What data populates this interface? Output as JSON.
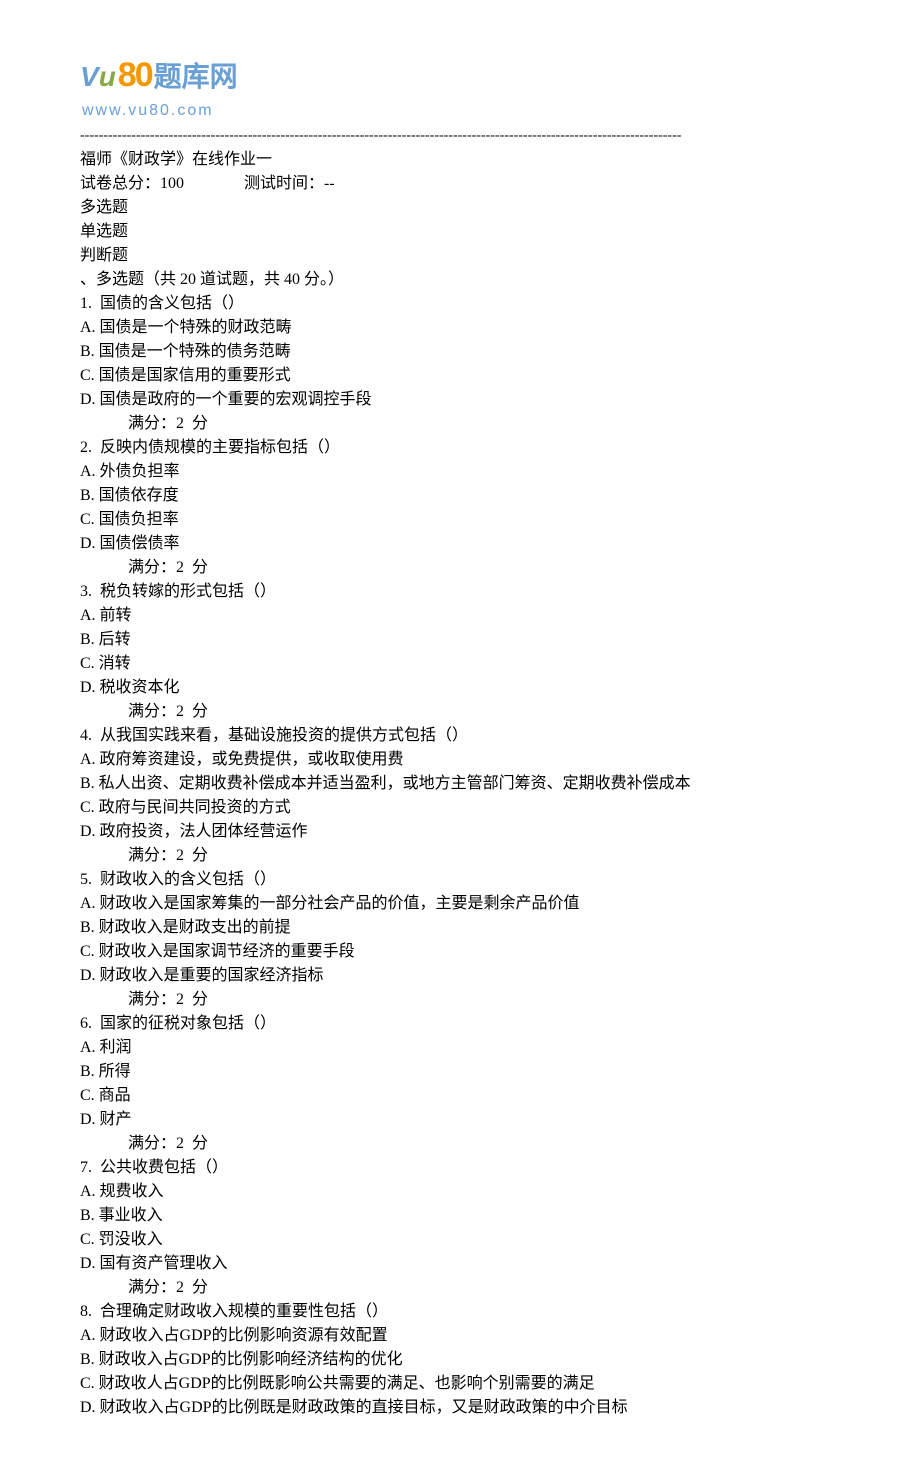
{
  "logo": {
    "v": "V",
    "u": "u",
    "num": "80",
    "cn": "题库网",
    "url": "www.vu80.com"
  },
  "header": {
    "title": "福师《财政学》在线作业一",
    "total_score_label": "试卷总分：100",
    "test_time_label": "测试时间：--"
  },
  "sections": {
    "multi": "多选题",
    "single": "单选题",
    "judge": "判断题"
  },
  "section_header": "、多选题（共 20 道试题，共 40 分。）",
  "score_line": "满分：2  分",
  "questions": [
    {
      "num": "1.",
      "text": "  国债的含义包括（）",
      "options": [
        "A. 国债是一个特殊的财政范畴",
        "B. 国债是一个特殊的债务范畴",
        "C. 国债是国家信用的重要形式",
        "D. 国债是政府的一个重要的宏观调控手段"
      ]
    },
    {
      "num": "2.",
      "text": "  反映内债规模的主要指标包括（）",
      "options": [
        "A. 外债负担率",
        "B. 国债依存度",
        "C. 国债负担率",
        "D. 国债偿债率"
      ]
    },
    {
      "num": "3.",
      "text": "  税负转嫁的形式包括（）",
      "options": [
        "A. 前转",
        "B. 后转",
        "C. 消转",
        "D. 税收资本化"
      ]
    },
    {
      "num": "4.",
      "text": "  从我国实践来看，基础设施投资的提供方式包括（）",
      "options": [
        "A. 政府筹资建设，或免费提供，或收取使用费",
        "B. 私人出资、定期收费补偿成本并适当盈利，或地方主管部门筹资、定期收费补偿成本",
        "C. 政府与民间共同投资的方式",
        "D. 政府投资，法人团体经营运作"
      ]
    },
    {
      "num": "5.",
      "text": "  财政收入的含义包括（）",
      "options": [
        "A. 财政收入是国家筹集的一部分社会产品的价值，主要是剩余产品价值",
        "B. 财政收入是财政支出的前提",
        "C. 财政收入是国家调节经济的重要手段",
        "D. 财政收入是重要的国家经济指标"
      ]
    },
    {
      "num": "6.",
      "text": "  国家的征税对象包括（）",
      "options": [
        "A. 利润",
        "B. 所得",
        "C. 商品",
        "D. 财产"
      ]
    },
    {
      "num": "7.",
      "text": "  公共收费包括（）",
      "options": [
        "A. 规费收入",
        "B. 事业收入",
        "C. 罚没收入",
        "D. 国有资产管理收入"
      ]
    },
    {
      "num": "8.",
      "text": "  合理确定财政收入规模的重要性包括（）",
      "options": [
        "A. 财政收入占GDP的比例影响资源有效配置",
        "B. 财政收入占GDP的比例影响经济结构的优化",
        "C. 财政收人占GDP的比例既影响公共需要的满足、也影响个别需要的满足",
        "D. 财政收入占GDP的比例既是财政政策的直接目标，又是财政政策的中介目标"
      ],
      "no_score": true
    }
  ]
}
